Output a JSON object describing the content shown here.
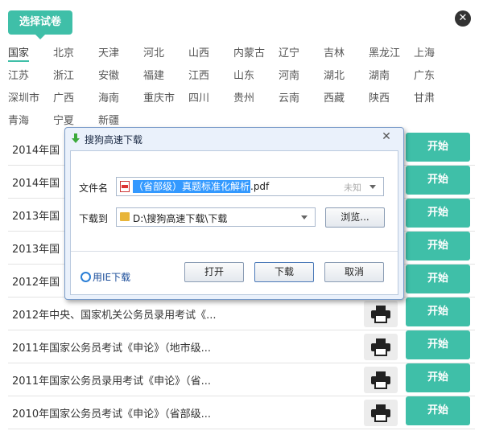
{
  "header": {
    "tab_label": "选择试卷",
    "close_symbol": "✕"
  },
  "provinces": [
    "国家",
    "北京",
    "天津",
    "河北",
    "山西",
    "内蒙古",
    "辽宁",
    "吉林",
    "黑龙江",
    "上海",
    "江苏",
    "浙江",
    "安徽",
    "福建",
    "江西",
    "山东",
    "河南",
    "湖北",
    "湖南",
    "广东",
    "深圳市",
    "广西",
    "海南",
    "重庆市",
    "四川",
    "贵州",
    "云南",
    "西藏",
    "陕西",
    "甘肃",
    "青海",
    "宁夏",
    "新疆"
  ],
  "selected_province": "国家",
  "rows": [
    {
      "title": "2014年国",
      "action": "开始"
    },
    {
      "title": "2014年国",
      "action": "开始"
    },
    {
      "title": "2013年国",
      "action": "开始"
    },
    {
      "title": "2013年国",
      "action": "开始"
    },
    {
      "title": "2012年国",
      "action": "开始"
    },
    {
      "title": "2012年中央、国家机关公务员录用考试《...",
      "action": "开始"
    },
    {
      "title": "2011年国家公务员考试《申论》（地市级...",
      "action": "开始"
    },
    {
      "title": "2011年国家公务员录用考试《申论》（省...",
      "action": "开始"
    },
    {
      "title": "2010年国家公务员考试《申论》（省部级...",
      "action": "开始"
    }
  ],
  "dialog": {
    "title": "搜狗高速下载",
    "close_symbol": "✕",
    "file_label": "文件名",
    "file_name_selected": "（省部级）真题标准化解析",
    "file_ext": ".pdf",
    "file_size": "未知",
    "dest_label": "下载到",
    "dest_path": "D:\\搜狗高速下载\\下载",
    "browse_label": "浏览...",
    "ie_link": "用IE下载",
    "open_label": "打开",
    "download_label": "下载",
    "cancel_label": "取消"
  },
  "colors": {
    "accent": "#3fbfa8",
    "dialog_bg": "#eaf1fb",
    "selection": "#3399ff"
  }
}
